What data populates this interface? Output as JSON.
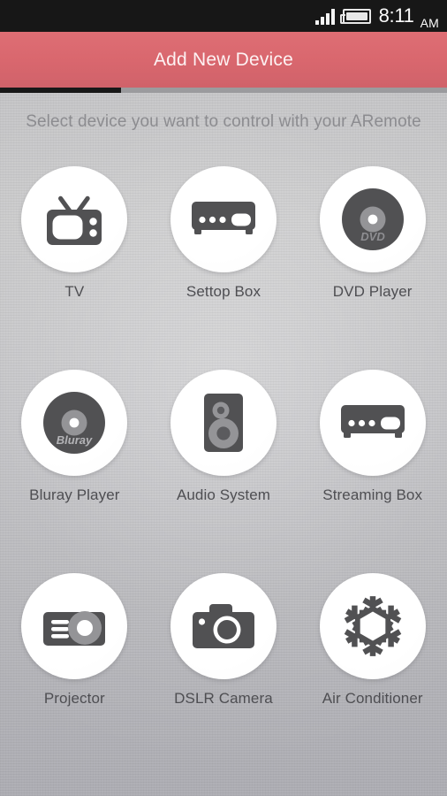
{
  "statusbar": {
    "time": "8:11",
    "ampm": "AM",
    "signal_icon": "signal-bars-icon",
    "battery_icon": "battery-icon"
  },
  "actionbar": {
    "title": "Add New Device",
    "accent_color": "#d9676e",
    "tab_indicator_color": "#181818"
  },
  "content": {
    "subtitle": "Select device you want to control with your ARemote",
    "background_color": "#c2c2c5",
    "icon_color": "#515153",
    "devices": [
      {
        "label": "TV",
        "icon": "tv-icon"
      },
      {
        "label": "Settop Box",
        "icon": "settop-box-icon"
      },
      {
        "label": "DVD Player",
        "icon": "dvd-disc-icon",
        "disc_text": "DVD"
      },
      {
        "label": "Bluray Player",
        "icon": "bluray-disc-icon",
        "disc_text": "Bluray"
      },
      {
        "label": "Audio System",
        "icon": "speaker-icon"
      },
      {
        "label": "Streaming Box",
        "icon": "streaming-box-icon"
      },
      {
        "label": "Projector",
        "icon": "projector-icon"
      },
      {
        "label": "DSLR Camera",
        "icon": "camera-icon"
      },
      {
        "label": "Air Conditioner",
        "icon": "snowflake-icon"
      }
    ]
  }
}
